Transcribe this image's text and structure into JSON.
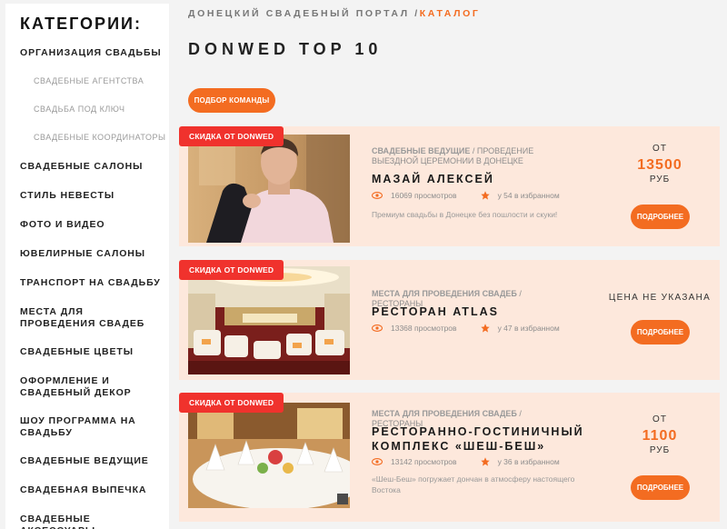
{
  "sidebar": {
    "title": "КАТЕГОРИИ:",
    "items": [
      {
        "label": "ОРГАНИЗАЦИЯ СВАДЬБЫ"
      },
      {
        "label": "СВАДЕБНЫЕ АГЕНТСТВА"
      },
      {
        "label": "СВАДЬБА ПОД КЛЮЧ"
      },
      {
        "label": "СВАДЕБНЫЕ КООРДИНАТОРЫ"
      },
      {
        "label": "СВАДЕБНЫЕ САЛОНЫ"
      },
      {
        "label": "СТИЛЬ НЕВЕСТЫ"
      },
      {
        "label": "ФОТО И ВИДЕО"
      },
      {
        "label": "ЮВЕЛИРНЫЕ САЛОНЫ"
      },
      {
        "label": "ТРАНСПОРТ НА СВАДЬБУ"
      },
      {
        "label": "МЕСТА ДЛЯ ПРОВЕДЕНИЯ СВАДЕБ"
      },
      {
        "label": "СВАДЕБНЫЕ ЦВЕТЫ"
      },
      {
        "label": "ОФОРМЛЕНИЕ И СВАДЕБНЫЙ ДЕКОР"
      },
      {
        "label": "ШОУ ПРОГРАММА НА СВАДЬБУ"
      },
      {
        "label": "СВАДЕБНЫЕ ВЕДУЩИЕ"
      },
      {
        "label": "СВАДЕБНАЯ ВЫПЕЧКА"
      },
      {
        "label": "СВАДЕБНЫЕ АКСЕССУАРЫ"
      }
    ]
  },
  "breadcrumb": {
    "home": "ДОНЕЦКИЙ СВАДЕБНЫЙ ПОРТАЛ",
    "separator": "/",
    "current": "КАТАЛОГ"
  },
  "page": {
    "title": "DONWED TOP 10",
    "team_button": "ПОДБОР КОМАНДЫ"
  },
  "colors": {
    "accent": "#f36c21",
    "badge": "#f0322d",
    "card_bg": "#fde8dc"
  },
  "cards": [
    {
      "badge": "СКИДКА ОТ DONWED",
      "category_primary": "СВАДЕБНЫЕ ВЕДУЩИЕ",
      "category_rest": " / ПРОВЕДЕНИЕ ВЫЕЗДНОЙ ЦЕРЕМОНИИ В ДОНЕЦКЕ",
      "name": "МАЗАЙ АЛЕКСЕЙ",
      "views": "16069 просмотров",
      "favorites": "у 54 в избранном",
      "description": "Премиум свадьбы в Донецке без пошлости и скуки!",
      "price_from": "ОТ",
      "price": "13500",
      "currency": "РУБ",
      "button": "ПОДРОБНЕЕ",
      "photo_icon": "man-portrait-photo"
    },
    {
      "badge": "СКИДКА ОТ DONWED",
      "category_primary": "МЕСТА ДЛЯ ПРОВЕДЕНИЯ СВАДЕБ",
      "category_rest": " / РЕСТОРАНЫ",
      "name": "РЕСТОРАН ATLAS",
      "views": "13368 просмотров",
      "favorites": "у 47 в избранном",
      "price_not_set": "ЦЕНА НЕ УКАЗАНА",
      "button": "ПОДРОБНЕЕ",
      "photo_icon": "restaurant-hall-photo"
    },
    {
      "badge": "СКИДКА ОТ DONWED",
      "category_primary": "МЕСТА ДЛЯ ПРОВЕДЕНИЯ СВАДЕБ",
      "category_rest": " / РЕСТОРАНЫ",
      "name": "РЕСТОРАННО-ГОСТИНИЧНЫЙ КОМПЛЕКС «ШЕШ-БЕШ»",
      "views": "13142 просмотров",
      "favorites": "у 36 в избранном",
      "description": "«Шеш-Беш» погружает дончан в атмосферу настоящего Востока",
      "price_from": "ОТ",
      "price": "1100",
      "currency": "РУБ",
      "button": "ПОДРОБНЕЕ",
      "photo_icon": "banquet-table-photo"
    }
  ]
}
